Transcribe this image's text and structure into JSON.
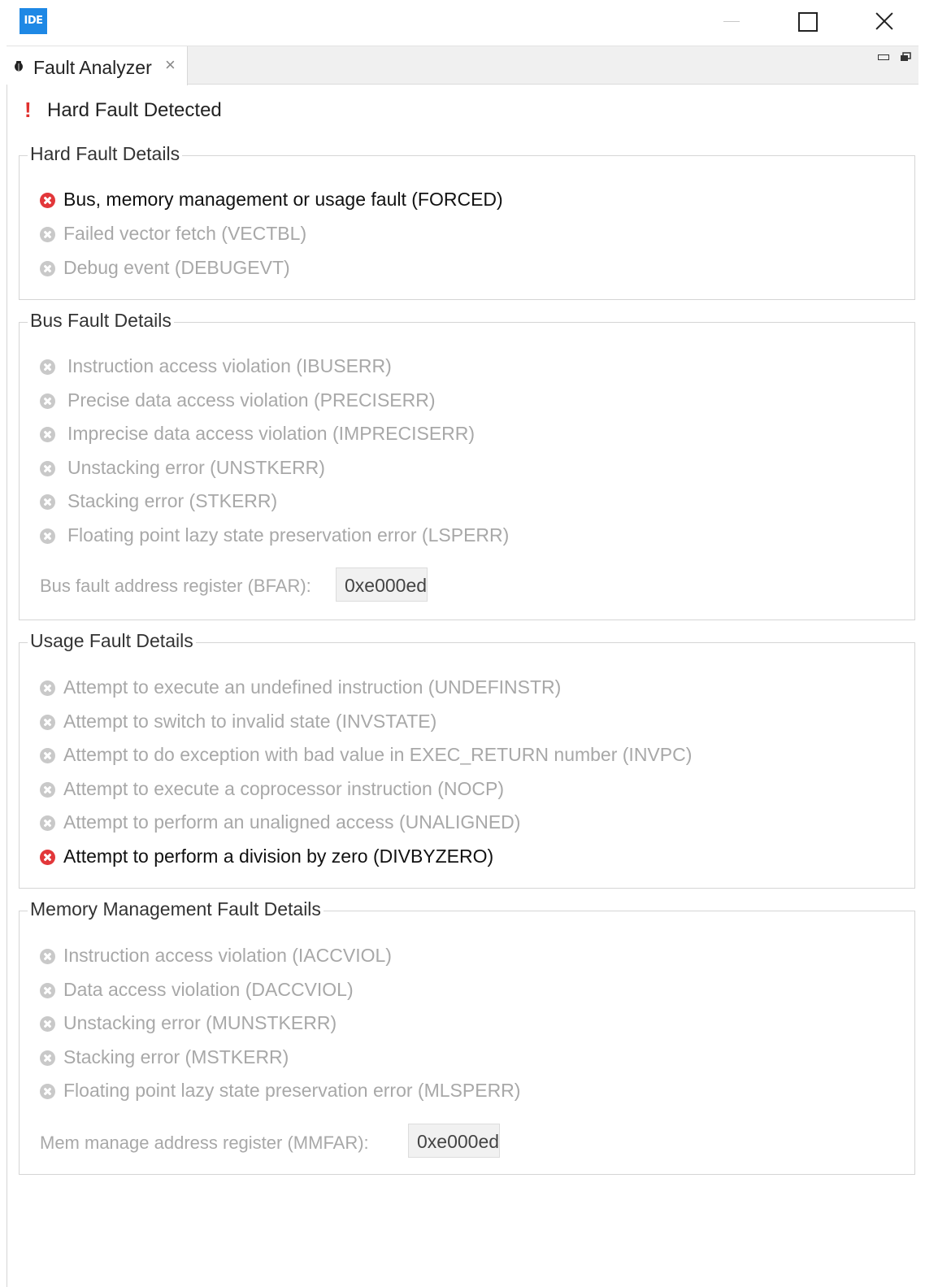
{
  "window": {
    "app_icon_text": "IDE",
    "controls": [
      "minimize-icon",
      "maximize-icon",
      "close-icon"
    ]
  },
  "tab": {
    "label": "Fault Analyzer",
    "close_glyph": "×",
    "icon": "bug-icon"
  },
  "header": {
    "icon": "exclamation-icon",
    "title": "Hard Fault Detected",
    "accent": "#e0302e"
  },
  "hard_fault": {
    "label": "Hard Fault Details",
    "items": [
      {
        "text": "Bus, memory management or usage fault (FORCED)",
        "active": true
      },
      {
        "text": "Failed vector fetch (VECTBL)",
        "active": false
      },
      {
        "text": "Debug event (DEBUGEVT)",
        "active": false
      }
    ]
  },
  "bus_fault": {
    "label": "Bus Fault Details",
    "items": [
      {
        "text": "Instruction access violation (IBUSERR)",
        "active": false
      },
      {
        "text": "Precise data access violation (PRECISERR)",
        "active": false
      },
      {
        "text": "Imprecise data access violation (IMPRECISERR)",
        "active": false
      },
      {
        "text": "Unstacking error (UNSTKERR)",
        "active": false
      },
      {
        "text": "Stacking error (STKERR)",
        "active": false
      },
      {
        "text": "Floating point lazy state preservation error (LSPERR)",
        "active": false
      }
    ],
    "register_label": "Bus fault address register (BFAR):",
    "register_value": "0xe000ed"
  },
  "usage_fault": {
    "label": "Usage Fault Details",
    "items": [
      {
        "text": "Attempt to execute an undefined instruction (UNDEFINSTR)",
        "active": false
      },
      {
        "text": "Attempt to switch to invalid state (INVSTATE)",
        "active": false
      },
      {
        "text": "Attempt to do exception with bad value in EXEC_RETURN number (INVPC)",
        "active": false
      },
      {
        "text": "Attempt to execute a coprocessor instruction (NOCP)",
        "active": false
      },
      {
        "text": "Attempt to perform an unaligned access (UNALIGNED)",
        "active": false
      },
      {
        "text": "Attempt to perform a division by zero (DIVBYZERO)",
        "active": true
      }
    ]
  },
  "mem_fault": {
    "label": "Memory Management Fault Details",
    "items": [
      {
        "text": "Instruction access violation (IACCVIOL)",
        "active": false
      },
      {
        "text": "Data access violation (DACCVIOL)",
        "active": false
      },
      {
        "text": "Unstacking error (MUNSTKERR)",
        "active": false
      },
      {
        "text": "Stacking error (MSTKERR)",
        "active": false
      },
      {
        "text": "Floating point lazy state preservation error (MLSPERR)",
        "active": false
      }
    ],
    "register_label": "Mem manage address register (MMFAR):",
    "register_value": "0xe000ed"
  },
  "colors": {
    "active_fault": "#e2373a",
    "inactive_fault": "#c9c9c9",
    "inactive_text": "#a8a8a8",
    "app_icon_bg": "#1e88e5"
  }
}
